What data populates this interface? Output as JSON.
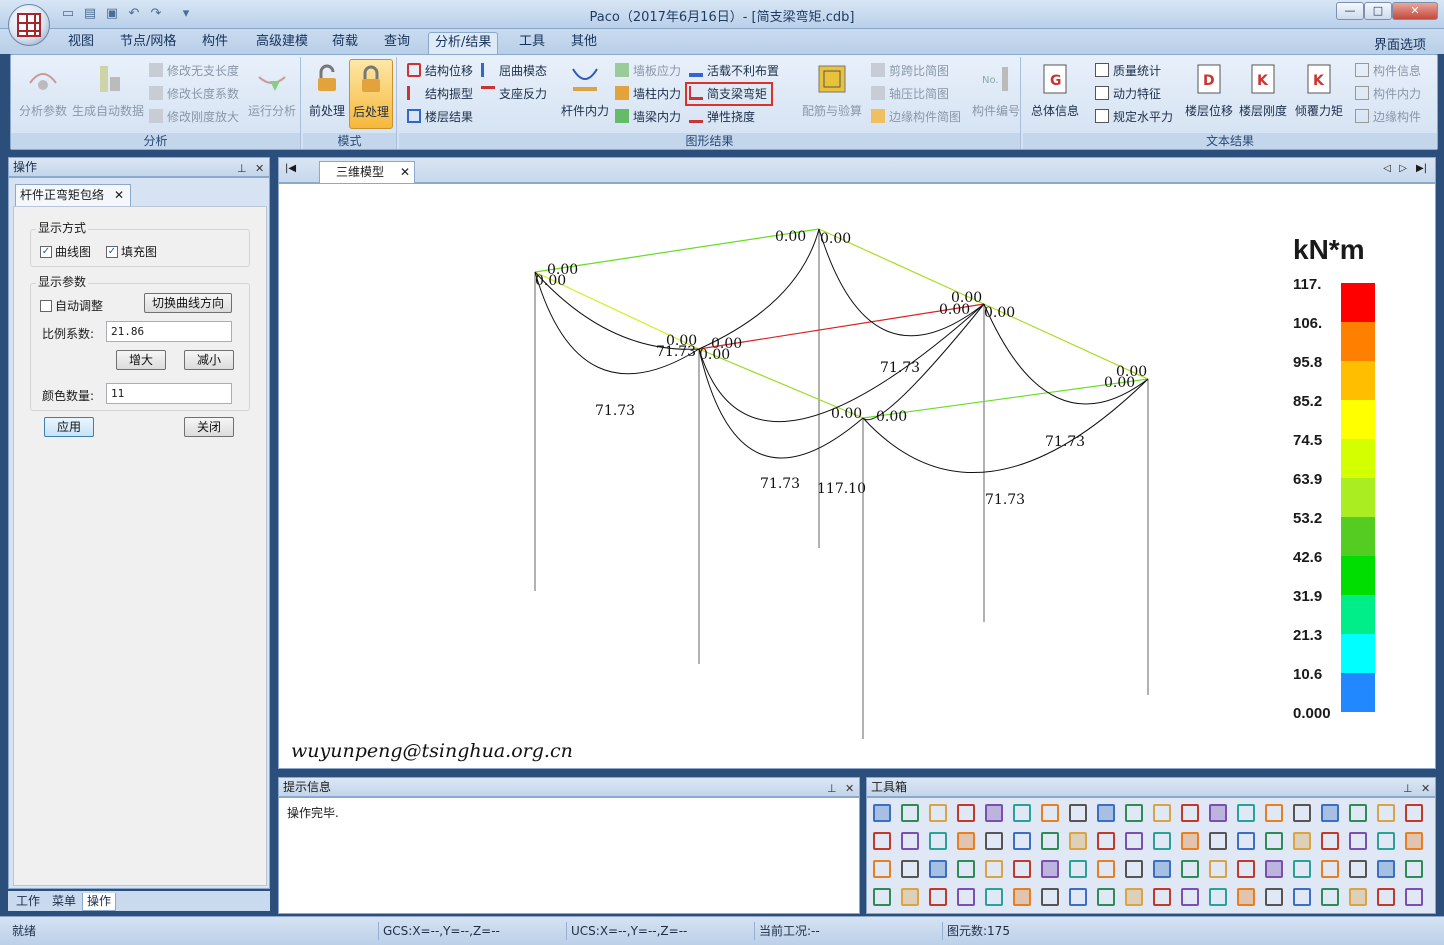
{
  "window": {
    "title": "Paco（2017年6月16日）- [简支梁弯矩.cdb]",
    "controls": [
      "—",
      "□",
      "✕"
    ]
  },
  "ribbon_tabs": [
    "视图",
    "节点/网格",
    "构件",
    "高级建模",
    "荷载",
    "查询",
    "分析/结果",
    "工具",
    "其他"
  ],
  "active_tab": "分析/结果",
  "ui_options_label": "界面选项",
  "ribbon": {
    "analysis": {
      "label": "分析",
      "analysis_params": "分析参数",
      "gen_data": "生成自动数据",
      "mod_unsupported_length": "修改无支长度",
      "mod_length_factor": "修改长度系数",
      "mod_stiffness_amp": "修改刚度放大",
      "run_analysis": "运行分析"
    },
    "mode": {
      "label": "模式",
      "pre": "前处理",
      "post": "后处理"
    },
    "graphic": {
      "label": "图形结果",
      "struct_disp": "结构位移",
      "buckling_mode": "屈曲模态",
      "struct_vibration": "结构振型",
      "support_reaction": "支座反力",
      "floor_result": "楼层结果",
      "member_force": "杆件内力",
      "wall_panel_stress": "墙板应力",
      "wall_column_force": "墙柱内力",
      "wall_beam_force": "墙梁内力",
      "live_load_adverse": "活载不利布置",
      "simple_beam_moment": "简支梁弯矩",
      "elastic_deflection": "弹性挠度",
      "reinforce_check": "配筋与验算",
      "shear_span_ratio": "剪跨比简图",
      "axial_ratio": "轴压比简图",
      "edge_member": "边缘构件简图",
      "member_number": "构件编号"
    },
    "text": {
      "label": "文本结果",
      "total_info": "总体信息",
      "mass_stats": "质量统计",
      "dynamic_char": "动力特征",
      "code_horizontal": "规定水平力",
      "floor_disp": "楼层位移",
      "floor_stiff": "楼层刚度",
      "overturn_moment": "倾覆力矩",
      "member_info": "构件信息",
      "member_force": "构件内力",
      "edge_member": "边缘构件"
    }
  },
  "operation_panel": {
    "header": "操作",
    "subtab": "杆件正弯矩包络",
    "display_mode_label": "显示方式",
    "curve_label": "曲线图",
    "fill_label": "填充图",
    "curve_checked": true,
    "fill_checked": true,
    "display_params_label": "显示参数",
    "auto_adjust_label": "自动调整",
    "auto_adjust_checked": false,
    "switch_curve_dir": "切换曲线方向",
    "scale_label": "比例系数:",
    "scale_value": "21.86",
    "increase": "增大",
    "decrease": "减小",
    "color_count_label": "颜色数量:",
    "color_count_value": "11",
    "apply": "应用",
    "close": "关闭"
  },
  "left_bottom_tabs": [
    "工作",
    "菜单",
    "操作"
  ],
  "doc_tab": "三维模型",
  "model_labels": {
    "zero": "0.00",
    "mid": "71.73",
    "max": "117.10"
  },
  "legend": {
    "unit": "kN*m",
    "values": [
      "117.",
      "106.",
      "95.8",
      "85.2",
      "74.5",
      "63.9",
      "53.2",
      "42.6",
      "31.9",
      "21.3",
      "10.6",
      "0.000"
    ],
    "colors": [
      "#ff0000",
      "#ff7f00",
      "#ffbf00",
      "#ffff00",
      "#d4ff00",
      "#aaee22",
      "#55cc22",
      "#00dd00",
      "#00ee88",
      "#00ffff",
      "#2288ff"
    ]
  },
  "watermark": "wuyunpeng@tsinghua.org.cn",
  "info_panel": {
    "header": "提示信息",
    "message": "操作完毕."
  },
  "toolbox": {
    "header": "工具箱"
  },
  "status": {
    "ready": "就绪",
    "gcs": "GCS:X=--,Y=--,Z=--",
    "ucs": "UCS:X=--,Y=--,Z=--",
    "case": "当前工况:--",
    "elements": "图元数:175"
  }
}
